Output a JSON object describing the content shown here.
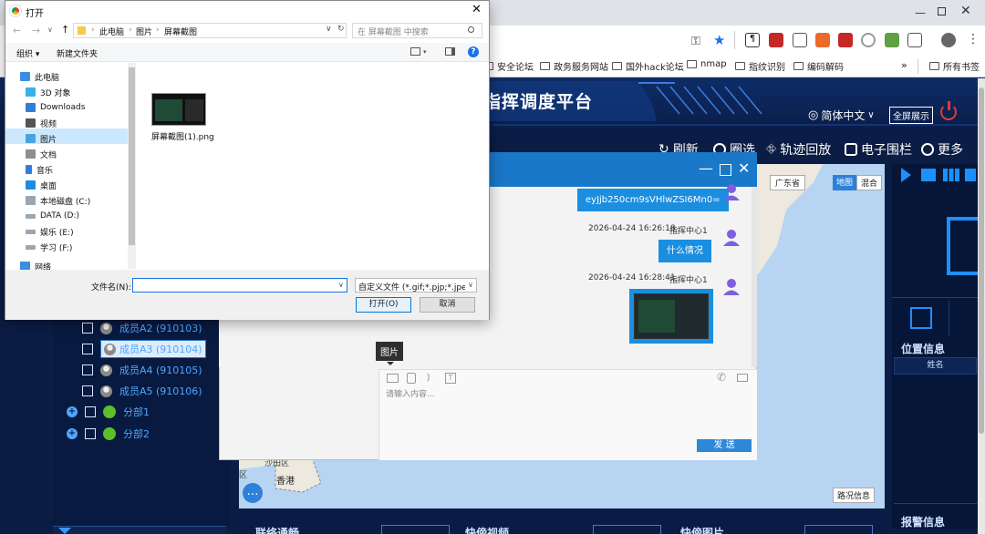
{
  "browser": {
    "tab_title": "打开",
    "bookmarks": [
      "安全论坛",
      "政务服务网站",
      "国外hack论坛",
      "nmap",
      "指纹识别",
      "编码解码"
    ],
    "bookmarks_more": "»",
    "bookmarks_all": "所有书签"
  },
  "app": {
    "title": "指挥调度平台",
    "language": "简体中文",
    "fullscreen_button": "全屏展示",
    "nav": {
      "refresh": "刷新",
      "select": "圈选",
      "track": "轨迹回放",
      "fence": "电子围栏",
      "more": "更多"
    },
    "tree": [
      {
        "label": "成员A2 (910103)"
      },
      {
        "label": "成员A3 (910104)"
      },
      {
        "label": "成员A4 (910105)"
      },
      {
        "label": "成员A5 (910106)"
      },
      {
        "label": "分部1"
      },
      {
        "label": "分部2"
      }
    ],
    "map": {
      "province_label": "广东省",
      "map_button": "地图",
      "hybrid_button": "混合",
      "city_label": "香港",
      "city_label2": "沙田区",
      "city_label3": "区",
      "traffic_button": "路况信息"
    },
    "right_panel": {
      "location_title": "位置信息",
      "name_col": "姓名",
      "alarm_title": "报警信息"
    },
    "bottom_tabs": [
      "联络通畅",
      "快傍视频",
      "快傍图片"
    ]
  },
  "chat": {
    "messages": [
      {
        "text": "eyJjb250cm9sVHlwZSI6Mn0=",
        "time": "",
        "sender": ""
      },
      {
        "text": "什么情况",
        "time": "2026-04-24 16:26:18",
        "sender": "指挥中心1"
      },
      {
        "text": "",
        "time": "2026-04-24 16:28:41",
        "sender": "指挥中心1",
        "image": true
      }
    ],
    "tooltip": "图片",
    "input_placeholder": "请输入内容...",
    "send_button": "发 送"
  },
  "dialog": {
    "title": "打开",
    "path": [
      "此电脑",
      "图片",
      "屏幕截图"
    ],
    "search_placeholder": "在 屏幕截图 中搜索",
    "organize": "组织 ▾",
    "new_folder": "新建文件夹",
    "sidebar": [
      {
        "label": "此电脑",
        "icon": "pc-icon"
      },
      {
        "label": "3D 对象",
        "icon": "cube-icon"
      },
      {
        "label": "Downloads",
        "icon": "download-icon"
      },
      {
        "label": "视频",
        "icon": "video-icon"
      },
      {
        "label": "图片",
        "icon": "picture-icon"
      },
      {
        "label": "文档",
        "icon": "document-icon"
      },
      {
        "label": "音乐",
        "icon": "music-icon"
      },
      {
        "label": "桌面",
        "icon": "desktop-icon"
      },
      {
        "label": "本地磁盘 (C:)",
        "icon": "drive-icon"
      },
      {
        "label": "DATA (D:)",
        "icon": "drive-icon"
      },
      {
        "label": "娱乐 (E:)",
        "icon": "drive-icon"
      },
      {
        "label": "学习 (F:)",
        "icon": "drive-icon"
      },
      {
        "label": "网络",
        "icon": "network-icon"
      }
    ],
    "file_name": "屏幕截图(1).png",
    "filename_label": "文件名(N):",
    "filename_value": "",
    "filetype": "自定义文件 (*.gif;*.pjp;*.jpe;*.",
    "open_button": "打开(O)",
    "cancel_button": "取消"
  }
}
